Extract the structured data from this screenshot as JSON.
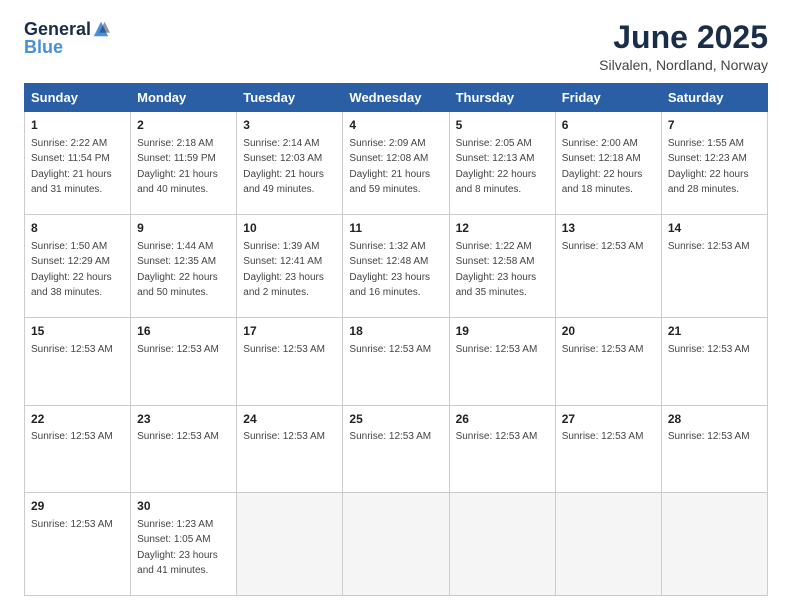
{
  "logo": {
    "general": "General",
    "blue": "Blue"
  },
  "header": {
    "month": "June 2025",
    "location": "Silvalen, Nordland, Norway"
  },
  "weekdays": [
    "Sunday",
    "Monday",
    "Tuesday",
    "Wednesday",
    "Thursday",
    "Friday",
    "Saturday"
  ],
  "weeks": [
    [
      {
        "day": "1",
        "info": "Sunrise: 2:22 AM\nSunset: 11:54 PM\nDaylight: 21 hours\nand 31 minutes."
      },
      {
        "day": "2",
        "info": "Sunrise: 2:18 AM\nSunset: 11:59 PM\nDaylight: 21 hours\nand 40 minutes."
      },
      {
        "day": "3",
        "info": "Sunrise: 2:14 AM\nSunset: 12:03 AM\nDaylight: 21 hours\nand 49 minutes."
      },
      {
        "day": "4",
        "info": "Sunrise: 2:09 AM\nSunset: 12:08 AM\nDaylight: 21 hours\nand 59 minutes."
      },
      {
        "day": "5",
        "info": "Sunrise: 2:05 AM\nSunset: 12:13 AM\nDaylight: 22 hours\nand 8 minutes."
      },
      {
        "day": "6",
        "info": "Sunrise: 2:00 AM\nSunset: 12:18 AM\nDaylight: 22 hours\nand 18 minutes."
      },
      {
        "day": "7",
        "info": "Sunrise: 1:55 AM\nSunset: 12:23 AM\nDaylight: 22 hours\nand 28 minutes."
      }
    ],
    [
      {
        "day": "8",
        "info": "Sunrise: 1:50 AM\nSunset: 12:29 AM\nDaylight: 22 hours\nand 38 minutes."
      },
      {
        "day": "9",
        "info": "Sunrise: 1:44 AM\nSunset: 12:35 AM\nDaylight: 22 hours\nand 50 minutes."
      },
      {
        "day": "10",
        "info": "Sunrise: 1:39 AM\nSunset: 12:41 AM\nDaylight: 23 hours\nand 2 minutes."
      },
      {
        "day": "11",
        "info": "Sunrise: 1:32 AM\nSunset: 12:48 AM\nDaylight: 23 hours\nand 16 minutes."
      },
      {
        "day": "12",
        "info": "Sunrise: 1:22 AM\nSunset: 12:58 AM\nDaylight: 23 hours\nand 35 minutes."
      },
      {
        "day": "13",
        "info": "Sunrise: 12:53 AM"
      },
      {
        "day": "14",
        "info": "Sunrise: 12:53 AM"
      }
    ],
    [
      {
        "day": "15",
        "info": "Sunrise: 12:53 AM"
      },
      {
        "day": "16",
        "info": "Sunrise: 12:53 AM"
      },
      {
        "day": "17",
        "info": "Sunrise: 12:53 AM"
      },
      {
        "day": "18",
        "info": "Sunrise: 12:53 AM"
      },
      {
        "day": "19",
        "info": "Sunrise: 12:53 AM"
      },
      {
        "day": "20",
        "info": "Sunrise: 12:53 AM"
      },
      {
        "day": "21",
        "info": "Sunrise: 12:53 AM"
      }
    ],
    [
      {
        "day": "22",
        "info": "Sunrise: 12:53 AM"
      },
      {
        "day": "23",
        "info": "Sunrise: 12:53 AM"
      },
      {
        "day": "24",
        "info": "Sunrise: 12:53 AM"
      },
      {
        "day": "25",
        "info": "Sunrise: 12:53 AM"
      },
      {
        "day": "26",
        "info": "Sunrise: 12:53 AM"
      },
      {
        "day": "27",
        "info": "Sunrise: 12:53 AM"
      },
      {
        "day": "28",
        "info": "Sunrise: 12:53 AM"
      }
    ],
    [
      {
        "day": "29",
        "info": "Sunrise: 12:53 AM"
      },
      {
        "day": "30",
        "info": "Sunrise: 1:23 AM\nSunset: 1:05 AM\nDaylight: 23 hours\nand 41 minutes."
      },
      {
        "day": "",
        "info": ""
      },
      {
        "day": "",
        "info": ""
      },
      {
        "day": "",
        "info": ""
      },
      {
        "day": "",
        "info": ""
      },
      {
        "day": "",
        "info": ""
      }
    ]
  ]
}
